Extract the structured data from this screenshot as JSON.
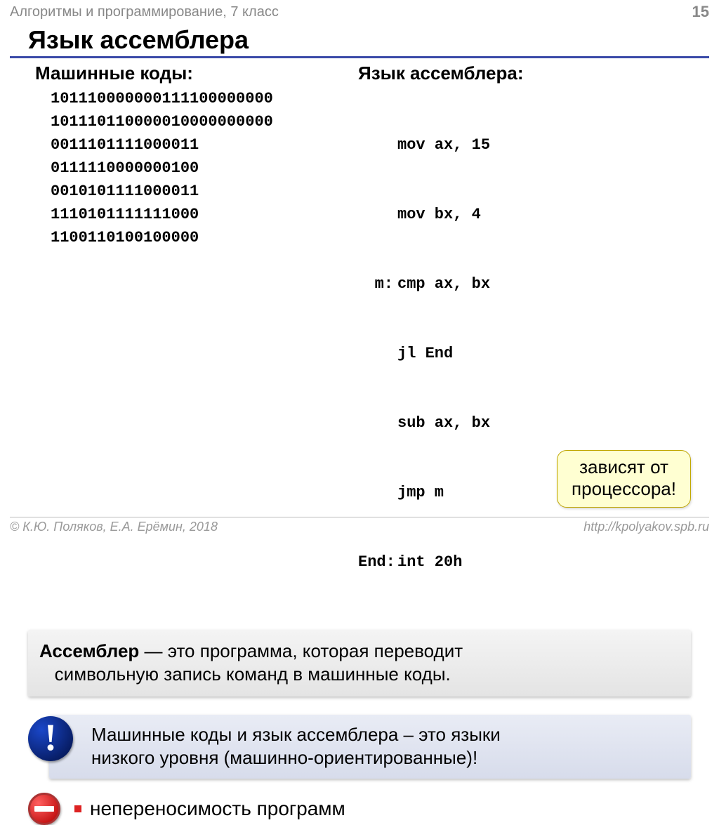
{
  "header": {
    "breadcrumb": "Алгоритмы и программирование, 7 класс",
    "page_number": "15"
  },
  "title": "Язык ассемблера",
  "left_col": {
    "heading": "Машинные коды:",
    "lines": [
      "101110000000111100000000",
      "101110110000010000000000",
      "0011101111000011",
      "0111110000000100",
      "0010101111000011",
      "1110101111111000",
      "1100110100100000"
    ]
  },
  "right_col": {
    "heading": "Язык ассемблера:",
    "lines": [
      {
        "label": "",
        "instr": "mov ax, 15"
      },
      {
        "label": "",
        "instr": "mov bx, 4"
      },
      {
        "label": "m:",
        "instr": "cmp ax, bx"
      },
      {
        "label": "",
        "instr": "jl End"
      },
      {
        "label": "",
        "instr": "sub ax, bx"
      },
      {
        "label": "",
        "instr": "jmp m"
      },
      {
        "label": "End:",
        "instr": "int 20h"
      }
    ]
  },
  "definition": {
    "term": "Ассемблер",
    "dash": " — ",
    "text_line1_rest": "это программа, которая переводит",
    "text_line2": "символьную запись команд в машинные коды."
  },
  "note": {
    "mark": "!",
    "line1": "Машинные коды и язык ассемблера – это языки",
    "line2": "низкого уровня (машинно-ориентированные)!"
  },
  "bottom": {
    "text": "непереносимость программ"
  },
  "callout": {
    "line1": "зависят от",
    "line2": "процессора!"
  },
  "footer": {
    "left": "© К.Ю. Поляков, Е.А. Ерёмин, 2018",
    "right": "http://kpolyakov.spb.ru"
  }
}
